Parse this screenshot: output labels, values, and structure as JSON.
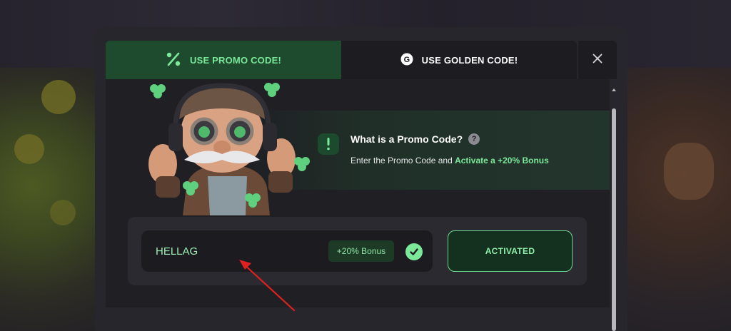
{
  "tabs": [
    {
      "label": "USE PROMO CODE!",
      "icon": "percent-icon",
      "active": true
    },
    {
      "label": "USE GOLDEN CODE!",
      "icon": "golden-coin-icon",
      "active": false
    }
  ],
  "close_icon": "close-icon",
  "info": {
    "title": "What is a Promo Code?",
    "help_icon": "?",
    "description_prefix": "Enter the Promo Code and ",
    "description_highlight": "Activate a +20% Bonus",
    "icon_glyph": "!"
  },
  "promo": {
    "code_value": "HELLAG",
    "bonus_badge": "+20% Bonus",
    "status_icon": "check-icon",
    "button_label": "ACTIVATED"
  },
  "colors": {
    "accent_green": "#7be89a",
    "active_tab_bg": "#1e4a2e",
    "modal_bg": "#27262c",
    "annotation_arrow": "#e02020"
  }
}
